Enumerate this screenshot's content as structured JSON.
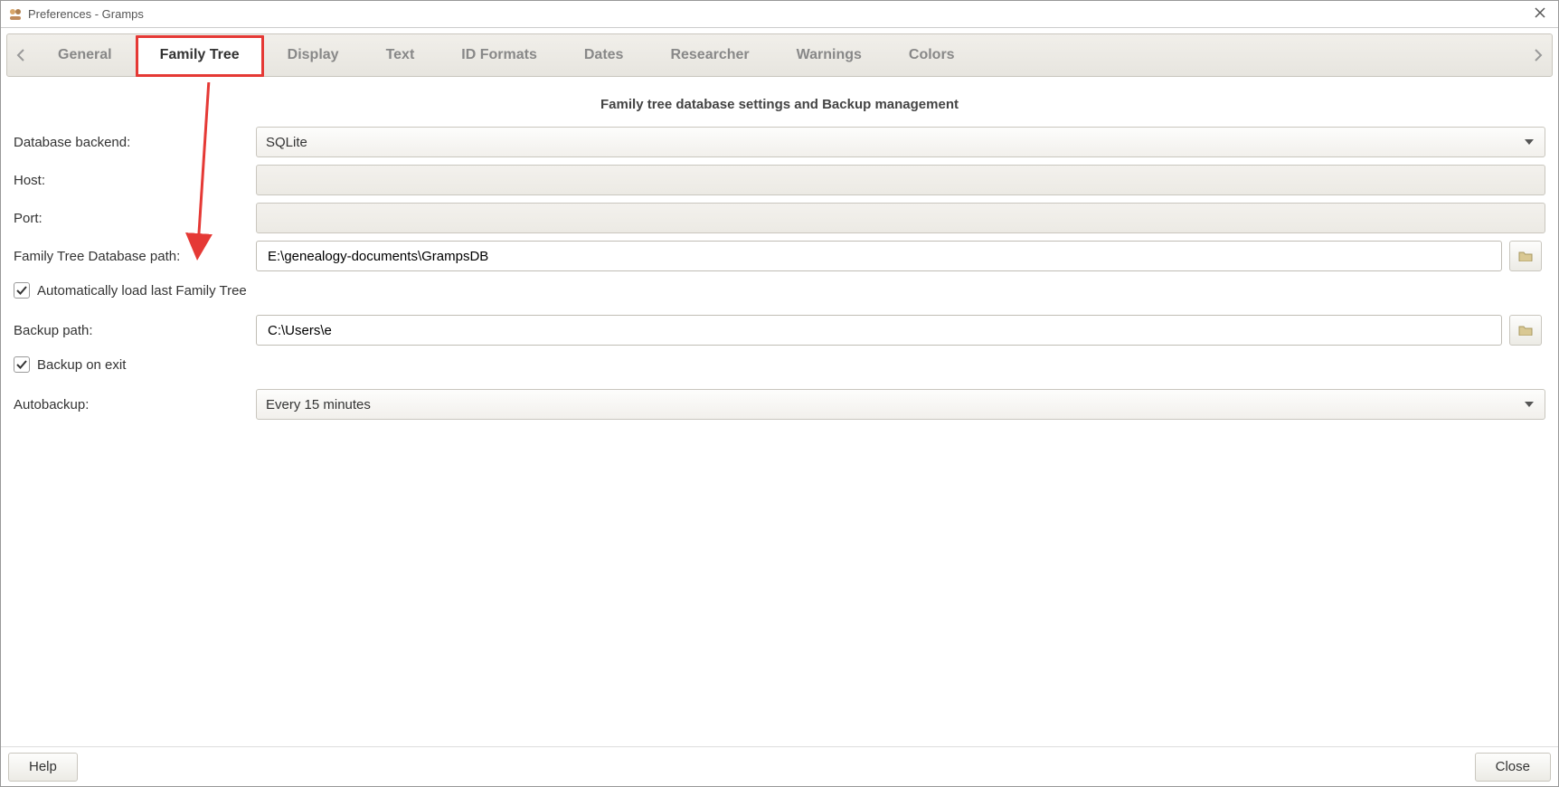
{
  "window": {
    "title": "Preferences - Gramps"
  },
  "tabs": {
    "items": [
      {
        "label": "General"
      },
      {
        "label": "Family Tree"
      },
      {
        "label": "Display"
      },
      {
        "label": "Text"
      },
      {
        "label": "ID Formats"
      },
      {
        "label": "Dates"
      },
      {
        "label": "Researcher"
      },
      {
        "label": "Warnings"
      },
      {
        "label": "Colors"
      }
    ],
    "active_index": 1
  },
  "section_title": "Family tree database settings and Backup management",
  "labels": {
    "database_backend": "Database backend:",
    "host": "Host:",
    "port": "Port:",
    "db_path": "Family Tree Database path:",
    "autoload": "Automatically load last Family Tree",
    "backup_path": "Backup path:",
    "backup_on_exit": "Backup on exit",
    "autobackup": "Autobackup:"
  },
  "values": {
    "database_backend": "SQLite",
    "host": "",
    "port": "",
    "db_path": "E:\\genealogy-documents\\GrampsDB",
    "autoload_checked": true,
    "backup_path": "C:\\Users\\e",
    "backup_on_exit_checked": true,
    "autobackup": "Every 15 minutes"
  },
  "buttons": {
    "help": "Help",
    "close": "Close"
  },
  "annotation": {
    "variant": "red-arrow-pointing-to-db-path-row",
    "tab_highlighted": "Family Tree"
  }
}
